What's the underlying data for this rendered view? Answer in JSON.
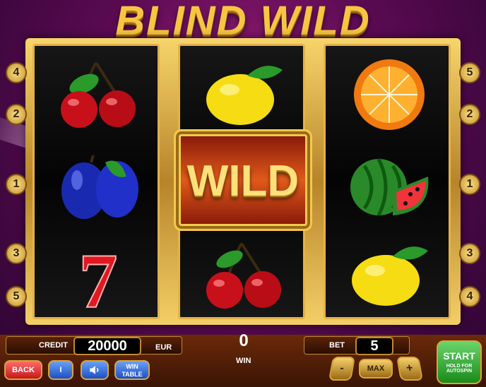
{
  "game": {
    "title": "BLIND WILD",
    "wild_label": "WILD"
  },
  "reels": [
    {
      "symbols": [
        "cherry",
        "plum",
        "seven"
      ]
    },
    {
      "symbols": [
        "lemon",
        "wild",
        "cherry"
      ]
    },
    {
      "symbols": [
        "orange",
        "watermelon",
        "lemon"
      ]
    }
  ],
  "paylines": {
    "left": [
      "4",
      "2",
      "1",
      "3",
      "5"
    ],
    "right": [
      "5",
      "2",
      "1",
      "3",
      "4"
    ]
  },
  "seven_label": "7",
  "status": {
    "credit_label": "CREDIT",
    "credit_value": "20000",
    "currency": "EUR",
    "win_value": "0",
    "win_label": "WIN",
    "bet_label": "BET",
    "bet_value": "5"
  },
  "buttons": {
    "back": "BACK",
    "info": "I",
    "win_table_line1": "WIN",
    "win_table_line2": "TABLE",
    "minus": "-",
    "max": "MAX",
    "plus": "+",
    "start": "START",
    "start_sub1": "HOLD FOR",
    "start_sub2": "AUTOSPIN"
  },
  "icons": {
    "sound": "speaker-icon"
  },
  "colors": {
    "background": "#5a0a52",
    "gold": "#f6c542",
    "start_green": "#1a8a1a",
    "back_red": "#c41818",
    "blue_button": "#1c4fc4"
  }
}
